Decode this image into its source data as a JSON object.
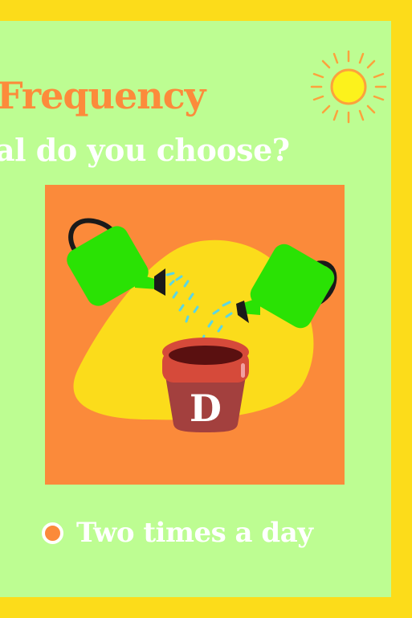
{
  "title": "Frequency",
  "question": "al do you choose?",
  "card": {
    "letter": "D",
    "icons": [
      "watering-can-icon",
      "flower-pot-icon",
      "sun-icon"
    ]
  },
  "option": {
    "label": "Two times a day",
    "selected": false
  },
  "colors": {
    "frame": "#FCDC1A",
    "background": "#BDFD92",
    "accent": "#FB8A3A",
    "text": "#FFFFFF",
    "blob": "#FBDC1B",
    "can": "#2AE204",
    "pot": "#D64A3A"
  }
}
